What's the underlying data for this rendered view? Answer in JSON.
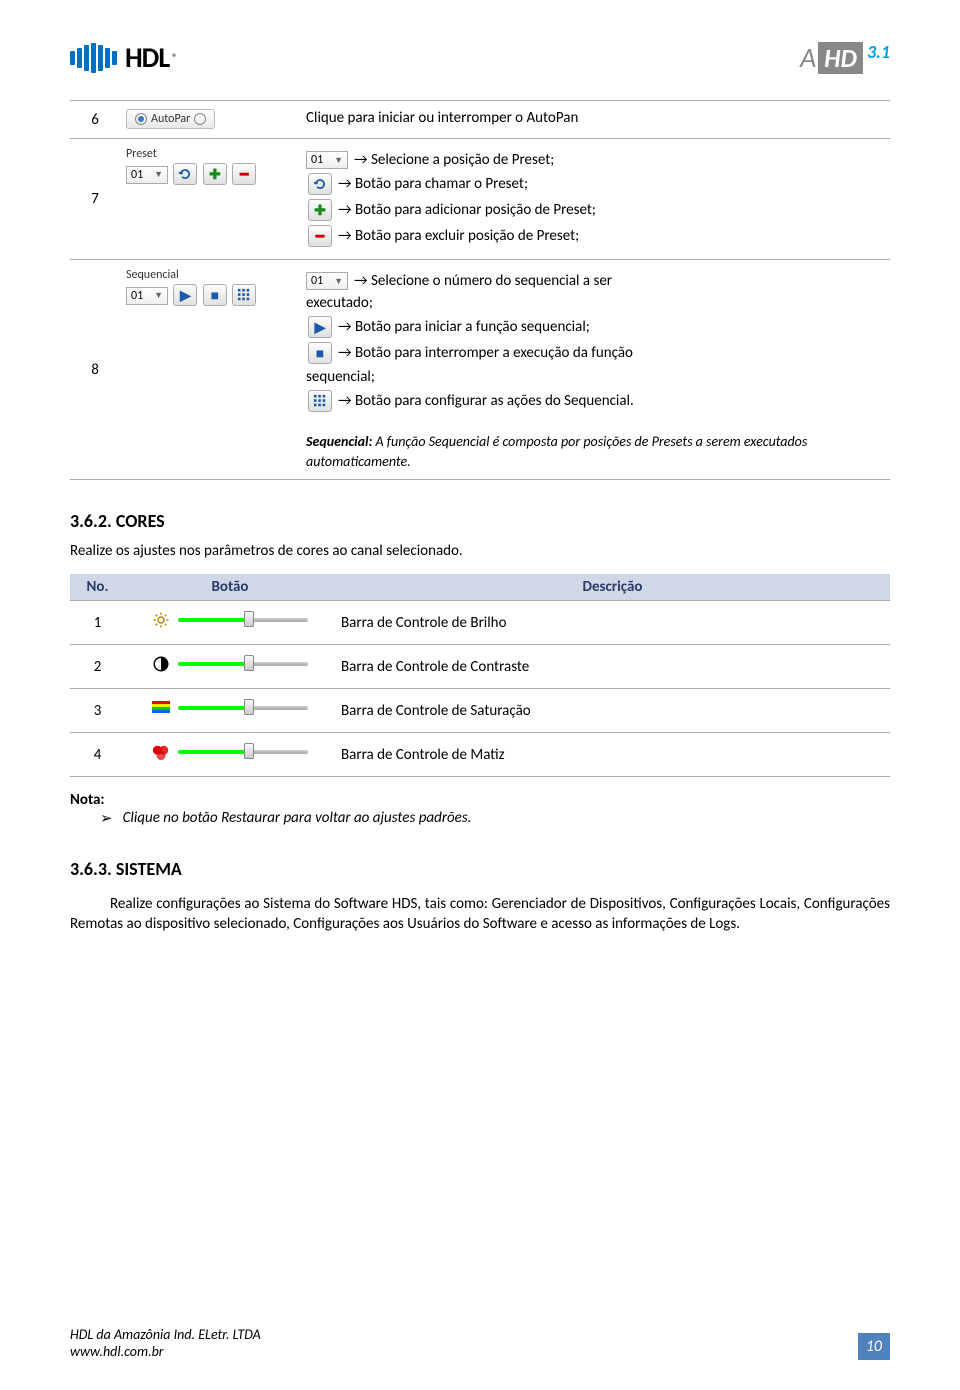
{
  "header": {
    "brand": "HDL",
    "brand_reg": "®",
    "ahd_a": "A",
    "ahd_hd": "HD",
    "ahd_ver": "3.1"
  },
  "table1": {
    "row6": {
      "num": "6",
      "autopan_label": "AutoPar",
      "desc": "Clique para iniciar ou interromper o AutoPan"
    },
    "row7": {
      "num": "7",
      "panel_label": "Preset",
      "dropdown_value": "01",
      "line1_pre": "01",
      "line1": "→ Selecione a posição de Preset;",
      "line2": "→ Botão para chamar o Preset;",
      "line3": "→ Botão para adicionar posição de Preset;",
      "line4": "→ Botão para excluir posição de Preset;"
    },
    "row8": {
      "num": "8",
      "panel_label": "Sequencial",
      "dropdown_value": "01",
      "line1_pre": "01",
      "line1_a": "→ Selecione o número do sequencial a ser",
      "line1_b": "executado;",
      "line2": "→ Botão para iniciar a função sequencial;",
      "line3_a": "→ Botão para interromper a execução da função",
      "line3_b": "sequencial;",
      "line4": "→ Botão para configurar as ações do Sequencial."
    },
    "seq_note_title": "Sequencial:",
    "seq_note_body": " A função Sequencial é composta por posições de Presets a serem executados automaticamente."
  },
  "cores": {
    "heading": "3.6.2. CORES",
    "intro": "Realize os ajustes nos parâmetros de cores ao canal selecionado.",
    "th_no": "No.",
    "th_btn": "Botão",
    "th_desc": "Descrição",
    "r1_num": "1",
    "r1_desc": "Barra de Controle de Brilho",
    "r2_num": "2",
    "r2_desc": "Barra de Controle de Contraste",
    "r3_num": "3",
    "r3_desc": "Barra de Controle de Saturação",
    "r4_num": "4",
    "r4_desc": "Barra de Controle de Matiz"
  },
  "nota": {
    "label": "Nota:",
    "bullet": "➢",
    "text": "Clique no botão Restaurar para voltar ao ajustes padrões."
  },
  "sistema": {
    "heading": "3.6.3. SISTEMA",
    "body": "Realize configurações ao Sistema do Software HDS, tais como: Gerenciador de Dispositivos, Configurações Locais, Configurações Remotas ao dispositivo selecionado, Configurações aos Usuários do Software e acesso as informações de Logs."
  },
  "footer": {
    "line1": "HDL da Amazônia Ind. ELetr. LTDA",
    "line2": "www.hdl.com.br",
    "page": "10"
  }
}
